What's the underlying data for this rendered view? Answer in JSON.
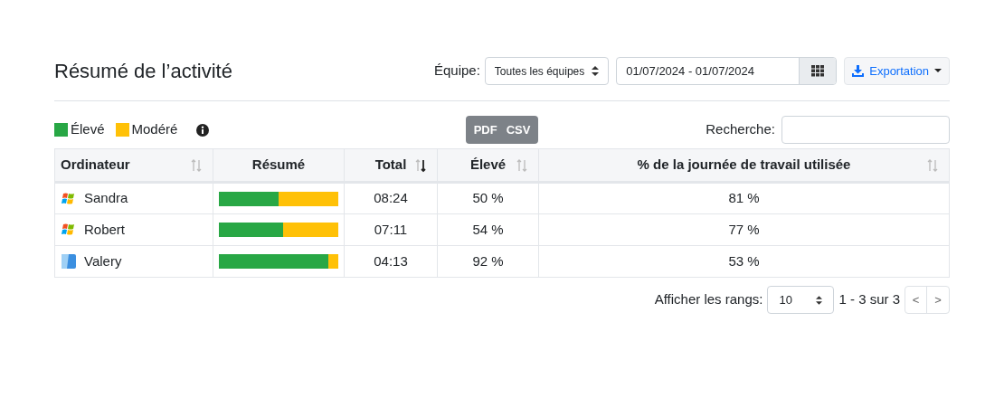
{
  "title": "Résumé de l’activité",
  "team": {
    "label": "Équipe:",
    "value": "Toutes les équipes"
  },
  "date_range": {
    "value": "01/07/2024 - 01/07/2024"
  },
  "export_button": {
    "label": "Exportation"
  },
  "legend": [
    {
      "label": "Élevé",
      "color": "#28a745"
    },
    {
      "label": "Modéré",
      "color": "#ffc107"
    }
  ],
  "download_buttons": [
    "PDF",
    "CSV"
  ],
  "search": {
    "label": "Recherche:"
  },
  "table": {
    "columns": [
      {
        "label": "Ordinateur",
        "sortable": true,
        "sorted": false
      },
      {
        "label": "Résumé",
        "sortable": false
      },
      {
        "label": "Total",
        "sortable": true,
        "sorted": true
      },
      {
        "label": "Élevé",
        "sortable": true,
        "sorted": false
      },
      {
        "label": "% de la journée de travail utilisée",
        "sortable": true,
        "sorted": false
      }
    ],
    "rows": [
      {
        "kind": "windows",
        "name": "Sandra",
        "level": 0.5,
        "total": "08:24",
        "high": "50 %",
        "workday": "81 %"
      },
      {
        "kind": "windows",
        "name": "Robert",
        "level": 0.54,
        "total": "07:11",
        "high": "54 %",
        "workday": "77 %"
      },
      {
        "kind": "mac",
        "name": "Valery",
        "level": 0.92,
        "total": "04:13",
        "high": "92 %",
        "workday": "53 %"
      }
    ]
  },
  "pagination": {
    "label": "Afficher les rangs:",
    "page_size": "10",
    "range": "1 - 3 sur 3",
    "prev": "<",
    "next": ">"
  }
}
